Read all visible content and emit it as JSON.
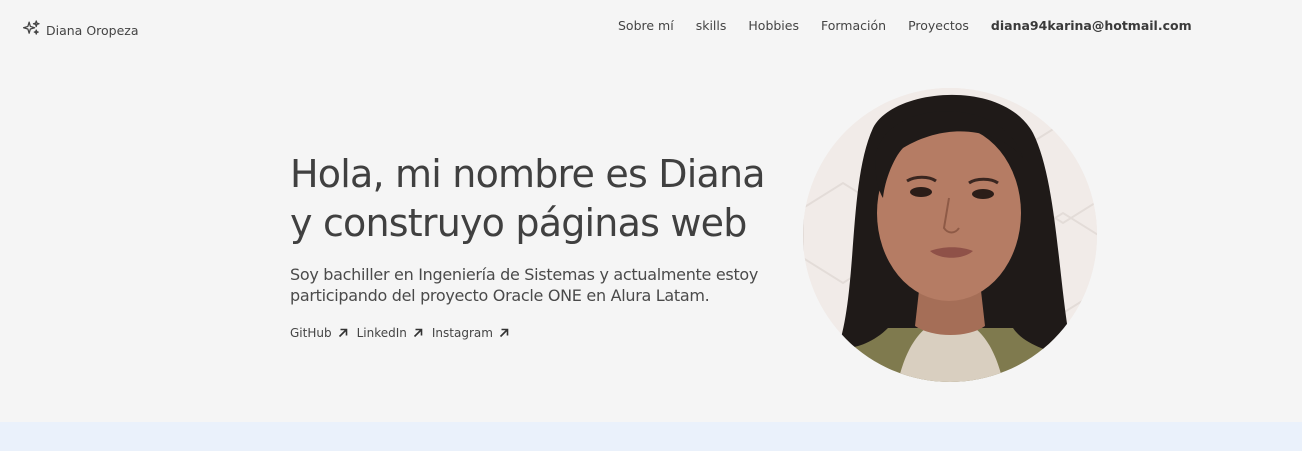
{
  "brand": {
    "name": "Diana Oropeza",
    "icon": "sparkles-icon"
  },
  "nav": {
    "items": [
      "Sobre mí",
      "skills",
      "Hobbies",
      "Formación",
      "Proyectos"
    ],
    "email": "diana94karina@hotmail.com"
  },
  "hero": {
    "title_line1": "Hola, mi nombre es Diana",
    "title_line2": "y construyo páginas web",
    "subtitle_line1": "Soy bachiller en Ingeniería de Sistemas y actualmente estoy",
    "subtitle_line2": "participando del proyecto Oracle ONE en Alura Latam.",
    "links": [
      "GitHub",
      "LinkedIn",
      "Instagram"
    ],
    "link_icon": "arrow-up-right-icon"
  },
  "colors": {
    "background": "#f5f5f5",
    "text": "#464646",
    "bottom_band": "#eaf1fb"
  }
}
